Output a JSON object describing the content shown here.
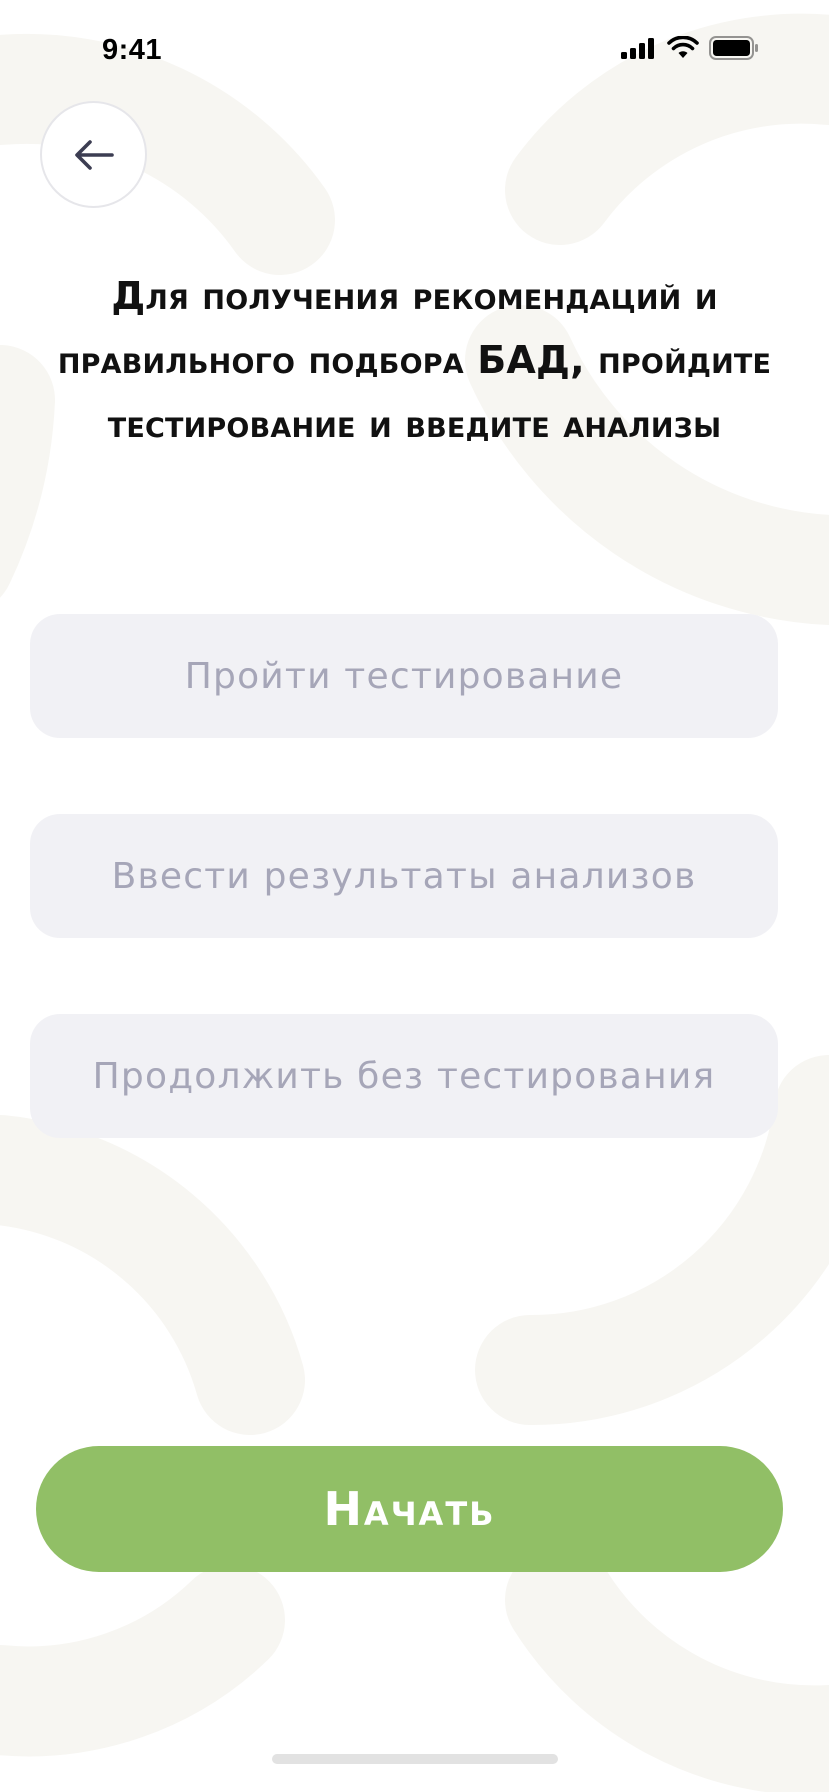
{
  "status_bar": {
    "time": "9:41"
  },
  "navigation": {
    "back_icon": "arrow-left-icon"
  },
  "page": {
    "title": "Для получения рекомендаций и правильного подбора БАД, пройдите тестирование и введите анализы"
  },
  "options": [
    {
      "label": "Пройти тестирование"
    },
    {
      "label": "Ввести результаты анализов"
    },
    {
      "label": "Продолжить без тестирования"
    }
  ],
  "start_button": {
    "label": "Начать"
  },
  "colors": {
    "accent": "#91bf66",
    "option_bg": "#f1f1f5",
    "option_text": "#a6a6b8",
    "decor": "#f7f6f2"
  }
}
